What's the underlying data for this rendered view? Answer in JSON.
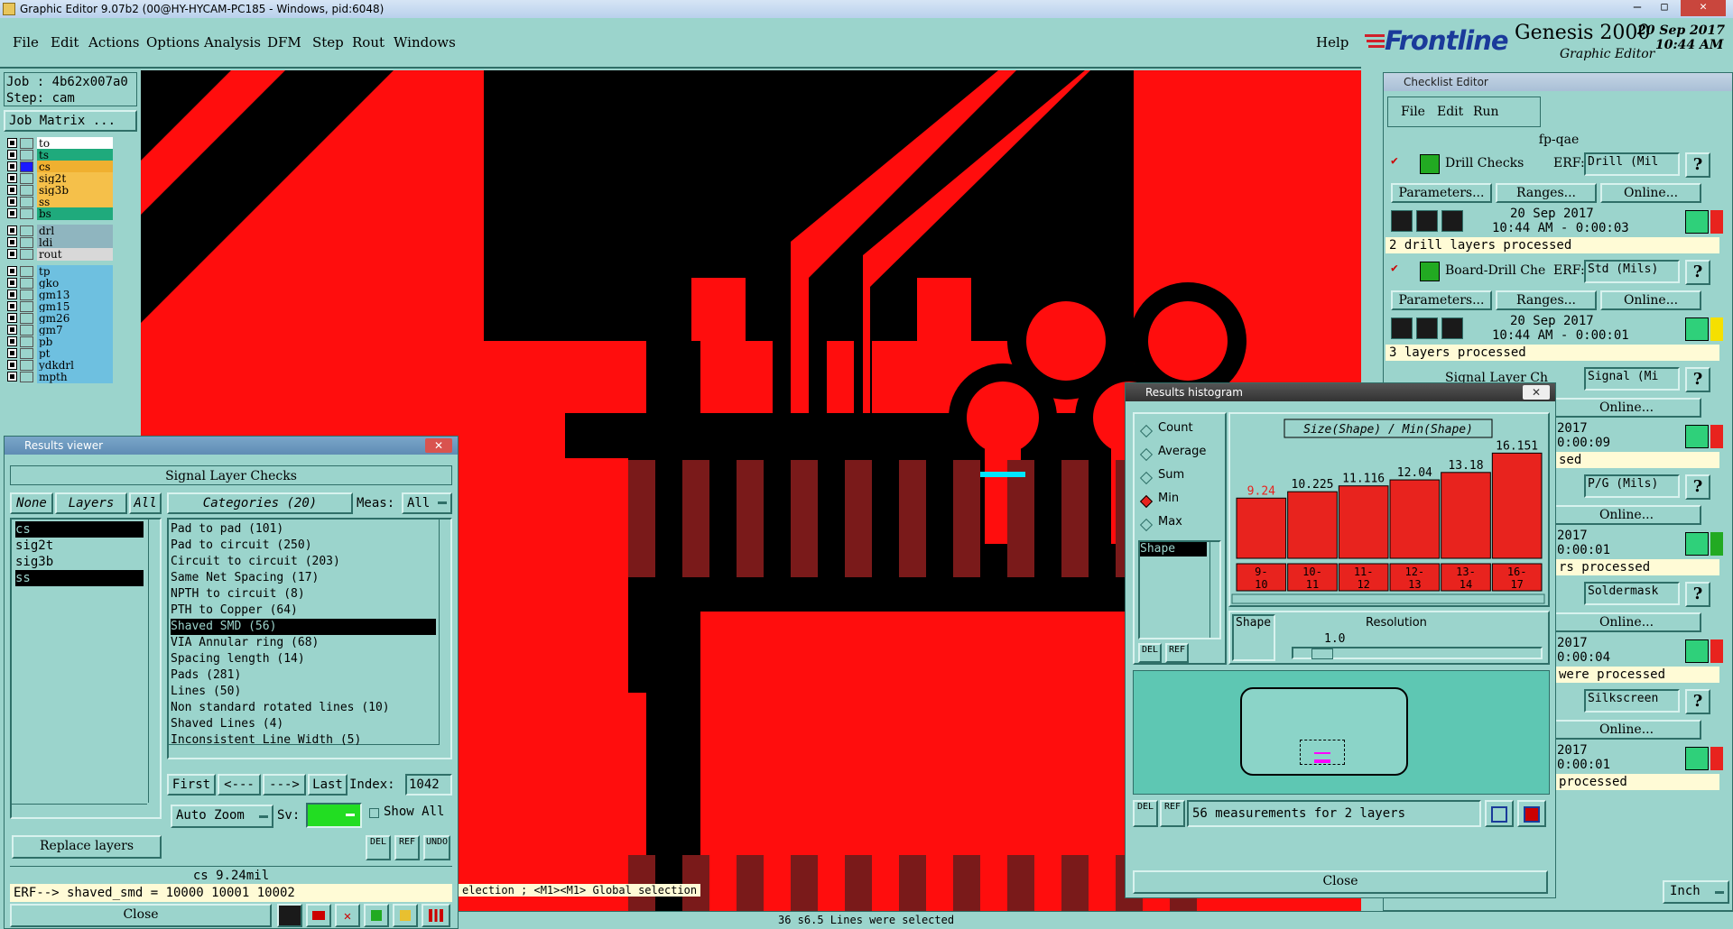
{
  "window": {
    "title": "Graphic Editor 9.07b2 (00@HY-HYCAM-PC185 - Windows, pid:6048)"
  },
  "menu": {
    "items": [
      "File",
      "Edit",
      "Actions",
      "Options",
      "Analysis",
      "DFM",
      "Step",
      "Rout",
      "Windows"
    ],
    "help": "Help"
  },
  "brand": {
    "logo": "Frontline",
    "product": "Genesis 2000",
    "subtitle": "Graphic Editor",
    "date": "20 Sep 2017",
    "time": "10:44 AM"
  },
  "job": {
    "job_label": "Job : 4b62x007a0",
    "step_label": "Step: cam",
    "matrix_button": "Job Matrix ..."
  },
  "layers": [
    {
      "name": "to",
      "color": "#ffffff"
    },
    {
      "name": "ts",
      "color": "#1faa7c"
    },
    {
      "name": "cs",
      "color": "#f0b030"
    },
    {
      "name": "sig2t",
      "color": "#f5c04a"
    },
    {
      "name": "sig3b",
      "color": "#f5c04a"
    },
    {
      "name": "ss",
      "color": "#f5c04a"
    },
    {
      "name": "bs",
      "color": "#1faa7c"
    },
    {
      "name": "drl",
      "color": "#8fb5bf"
    },
    {
      "name": "ldi",
      "color": "#8fb5bf"
    },
    {
      "name": "rout",
      "color": "#d8d8d8"
    },
    {
      "name": "tp",
      "color": "#6ec0e0"
    },
    {
      "name": "gko",
      "color": "#6ec0e0"
    },
    {
      "name": "gm13",
      "color": "#6ec0e0"
    },
    {
      "name": "gm15",
      "color": "#6ec0e0"
    },
    {
      "name": "gm26",
      "color": "#6ec0e0"
    },
    {
      "name": "gm7",
      "color": "#6ec0e0"
    },
    {
      "name": "pb",
      "color": "#6ec0e0"
    },
    {
      "name": "pt",
      "color": "#6ec0e0"
    },
    {
      "name": "ydkdrl",
      "color": "#6ec0e0"
    },
    {
      "name": "mpth",
      "color": "#6ec0e0"
    }
  ],
  "results_viewer": {
    "title": "Results viewer",
    "header": "Signal Layer Checks",
    "none_btn": "None",
    "layers_btn": "Layers",
    "all_btn": "All",
    "layer_list": [
      "cs",
      "sig2t",
      "sig3b",
      "ss"
    ],
    "categories_btn": "Categories (20)",
    "meas_label": "Meas:",
    "meas_value": "All",
    "categories": [
      "Pad to pad (101)",
      "Pad to circuit (250)",
      "Circuit to circuit (203)",
      "Same Net Spacing (17)",
      "NPTH to circuit (8)",
      "PTH to Copper (64)",
      "Shaved SMD (56)",
      "VIA Annular ring (68)",
      "Spacing length (14)",
      "Pads (281)",
      "Lines (50)",
      "Non standard rotated lines (10)",
      "Shaved Lines (4)",
      "Inconsistent Line Width (5)"
    ],
    "first_btn": "First",
    "prev_btn": "<---",
    "next_btn": "--->",
    "last_btn": "Last",
    "index_label": "Index:",
    "index_value": "1042",
    "zoom_btn": "Auto Zoom",
    "sv_label": "Sv:",
    "show_all": "Show All",
    "replace_btn": "Replace layers",
    "status": "cs 9.24mil",
    "erf_line": "ERF--> shaved_smd = 10000 10001 10002",
    "close_btn": "Close",
    "del": "DEL",
    "ref": "REF",
    "undo": "UNDO"
  },
  "histogram": {
    "title": "Results histogram",
    "options": [
      "Count",
      "Average",
      "Sum",
      "Min",
      "Max"
    ],
    "selected_option": "Min",
    "list_item": "Shape",
    "chart_title": "Size(Shape) / Min(Shape)",
    "chart_data": {
      "type": "bar",
      "title": "Size(Shape) / Min(Shape)",
      "categories": [
        "9-10",
        "10-11",
        "11-12",
        "12-13",
        "13-14",
        "16-17"
      ],
      "values": [
        9.24,
        10.225,
        11.116,
        12.04,
        13.18,
        16.151
      ],
      "value_labels": [
        "9.24",
        "10.225",
        "11.116",
        "12.04",
        "13.18",
        "16.151"
      ],
      "ylim": [
        0,
        18
      ]
    },
    "bin_labels": [
      [
        "9-",
        "10"
      ],
      [
        "10-",
        "11"
      ],
      [
        "11-",
        "12"
      ],
      [
        "12-",
        "13"
      ],
      [
        "13-",
        "14"
      ],
      [
        "16-",
        "17"
      ]
    ],
    "shape_label": "Shape",
    "resolution_label": "Resolution",
    "resolution_value": "1.0",
    "measurements": "56 measurements for 2 layers",
    "close_btn": "Close",
    "del": "DEL",
    "ref": "REF"
  },
  "checklist": {
    "title": "Checklist Editor",
    "menu": [
      "File",
      "Edit",
      "Run"
    ],
    "name": "fp-qae",
    "erf": "ERF:",
    "params_btn": "Parameters...",
    "ranges_btn": "Ranges...",
    "online_btn": "Online...",
    "checks": [
      {
        "name": "Drill Checks",
        "erf": "Drill (Mil",
        "date": "20 Sep 2017",
        "time": "10:44 AM - 0:00:03",
        "status": "2 drill layers processed"
      },
      {
        "name": "Board-Drill Che",
        "erf": "Std (Mils)",
        "date": "20 Sep 2017",
        "time": "10:44 AM - 0:00:01",
        "status": "3 layers processed"
      },
      {
        "name": "Signal Layer Ch",
        "erf": "Signal (Mi",
        "date": "2017",
        "time": "0:00:09",
        "status": "sed"
      },
      {
        "name": "",
        "erf": "P/G (Mils)",
        "date": "2017",
        "time": "0:00:01",
        "status": "rs processed"
      },
      {
        "name": "",
        "erf": "Soldermask",
        "date": "2017",
        "time": "0:00:04",
        "status": "were processed"
      },
      {
        "name": "",
        "erf": "Silkscreen",
        "date": "2017",
        "time": "0:00:01",
        "status": "processed"
      }
    ],
    "partial_labels": [
      "s...",
      "F:",
      "s...",
      "F:",
      "s...",
      "F:",
      "s...",
      "ose"
    ]
  },
  "canvas": {
    "message": "election ; <M1><M1> Global selection"
  },
  "statusbar": {
    "text": "36 s6.5 Lines were selected",
    "units": "Inch"
  },
  "colors": {
    "copper": "#ff0d0d",
    "background": "#000000",
    "highlight": "#00e5ff",
    "panel": "#9bd4cc",
    "dark_pad": "#7a1a1a"
  }
}
